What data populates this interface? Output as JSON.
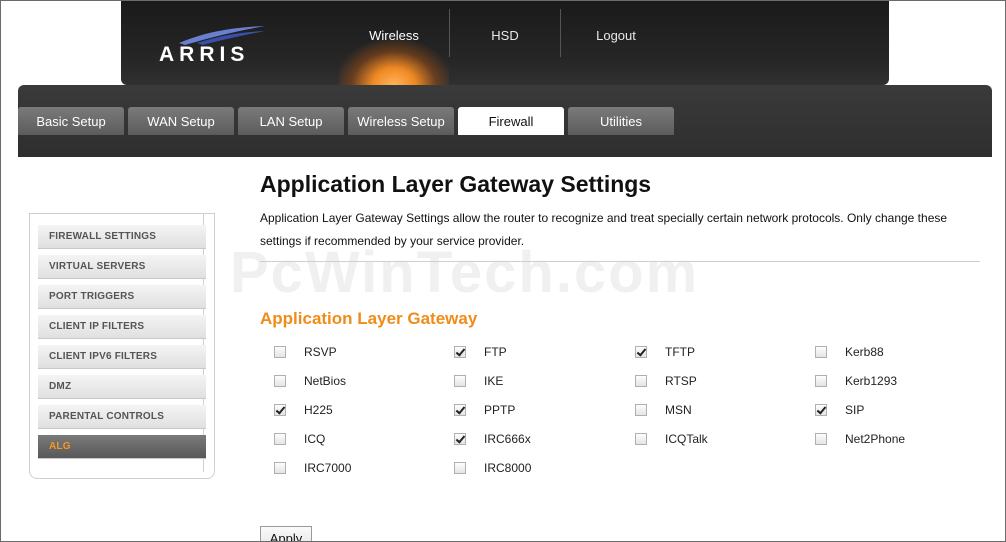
{
  "brand": {
    "logo_text": "ARRIS"
  },
  "top_nav": [
    {
      "label": "Wireless",
      "active": true
    },
    {
      "label": "HSD",
      "active": false
    },
    {
      "label": "Logout",
      "active": false
    }
  ],
  "tabs": [
    {
      "label": "Basic Setup",
      "active": false
    },
    {
      "label": "WAN Setup",
      "active": false
    },
    {
      "label": "LAN Setup",
      "active": false
    },
    {
      "label": "Wireless Setup",
      "active": false
    },
    {
      "label": "Firewall",
      "active": true
    },
    {
      "label": "Utilities",
      "active": false
    }
  ],
  "sidebar": {
    "items": [
      {
        "label": "FIREWALL SETTINGS",
        "active": false
      },
      {
        "label": "VIRTUAL SERVERS",
        "active": false
      },
      {
        "label": "PORT TRIGGERS",
        "active": false
      },
      {
        "label": "CLIENT IP FILTERS",
        "active": false
      },
      {
        "label": "CLIENT IPV6 FILTERS",
        "active": false
      },
      {
        "label": "DMZ",
        "active": false
      },
      {
        "label": "PARENTAL CONTROLS",
        "active": false
      },
      {
        "label": "ALG",
        "active": true
      }
    ]
  },
  "main": {
    "title": "Application Layer Gateway Settings",
    "description": "Application Layer Gateway Settings allow the router to recognize and treat specially certain network protocols. Only change these settings if recommended by your service provider.",
    "watermark": "PcWinTech.com",
    "section_title": "Application Layer Gateway",
    "options": [
      {
        "label": "RSVP",
        "checked": false
      },
      {
        "label": "FTP",
        "checked": true
      },
      {
        "label": "TFTP",
        "checked": true
      },
      {
        "label": "Kerb88",
        "checked": false
      },
      {
        "label": "NetBios",
        "checked": false
      },
      {
        "label": "IKE",
        "checked": false
      },
      {
        "label": "RTSP",
        "checked": false
      },
      {
        "label": "Kerb1293",
        "checked": false
      },
      {
        "label": "H225",
        "checked": true
      },
      {
        "label": "PPTP",
        "checked": true
      },
      {
        "label": "MSN",
        "checked": false
      },
      {
        "label": "SIP",
        "checked": true
      },
      {
        "label": "ICQ",
        "checked": false
      },
      {
        "label": "IRC666x",
        "checked": true
      },
      {
        "label": "ICQTalk",
        "checked": false
      },
      {
        "label": "Net2Phone",
        "checked": false
      },
      {
        "label": "IRC7000",
        "checked": false
      },
      {
        "label": "IRC8000",
        "checked": false
      }
    ],
    "apply_label": "Apply"
  },
  "colors": {
    "accent": "#f08c1a",
    "header_bg": "#262626",
    "tab_bg": "#666666"
  }
}
